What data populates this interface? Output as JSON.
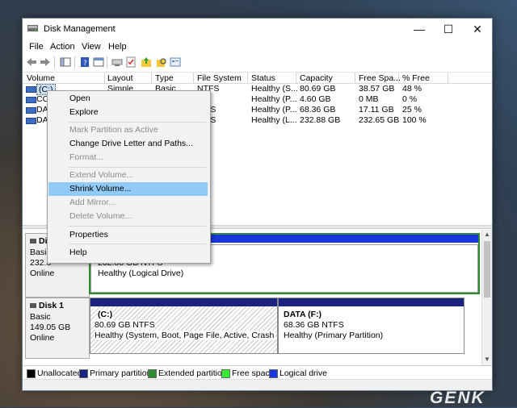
{
  "window": {
    "title": "Disk Management"
  },
  "menu": [
    "File",
    "Action",
    "View",
    "Help"
  ],
  "columns": [
    "Volume",
    "Layout",
    "Type",
    "File System",
    "Status",
    "Capacity",
    "Free Spa...",
    "% Free"
  ],
  "volumes": [
    {
      "name": "(C:)",
      "layout": "Simple",
      "type": "Basic",
      "fs": "NTFS",
      "status": "Healthy (S...",
      "capacity": "80.69 GB",
      "free": "38.57 GB",
      "pct": "48 %"
    },
    {
      "name": "CC...",
      "layout": "",
      "type": "",
      "fs": "",
      "status": "Healthy (P...",
      "capacity": "4.60 GB",
      "free": "0 MB",
      "pct": "0 %"
    },
    {
      "name": "DAT...",
      "layout": "",
      "type": "",
      "fs": "FS",
      "status": "Healthy (P...",
      "capacity": "68.36 GB",
      "free": "17.11 GB",
      "pct": "25 %"
    },
    {
      "name": "DAT...",
      "layout": "",
      "type": "",
      "fs": "FS",
      "status": "Healthy (L...",
      "capacity": "232.88 GB",
      "free": "232.65 GB",
      "pct": "100 %"
    }
  ],
  "context_menu": {
    "open": "Open",
    "explore": "Explore",
    "mark_active": "Mark Partition as Active",
    "change_letter": "Change Drive Letter and Paths...",
    "format": "Format...",
    "extend": "Extend Volume...",
    "shrink": "Shrink Volume...",
    "add_mirror": "Add Mirror...",
    "delete": "Delete Volume...",
    "properties": "Properties",
    "help": "Help"
  },
  "disks": {
    "disk0": {
      "name": "Di",
      "type": "Basic",
      "size": "232.8",
      "state": "Online",
      "partition_size": "232.88 GB NTFS",
      "partition_status": "Healthy (Logical Drive)"
    },
    "disk1": {
      "name": "Disk 1",
      "type": "Basic",
      "size": "149.05 GB",
      "state": "Online",
      "c_label": "(C:)",
      "c_size": "80.69 GB NTFS",
      "c_status": "Healthy (System, Boot, Page File, Active, Crash Dump,",
      "f_label": "DATA  (F:)",
      "f_size": "68.36 GB NTFS",
      "f_status": "Healthy (Primary Partition)"
    }
  },
  "legend": [
    {
      "label": "Unallocated",
      "color": "#000000"
    },
    {
      "label": "Primary partition",
      "color": "#1a237e"
    },
    {
      "label": "Extended partition",
      "color": "#2e8b2e"
    },
    {
      "label": "Free space",
      "color": "#33ee33"
    },
    {
      "label": "Logical drive",
      "color": "#1a35e0"
    }
  ],
  "watermark": "GENK"
}
